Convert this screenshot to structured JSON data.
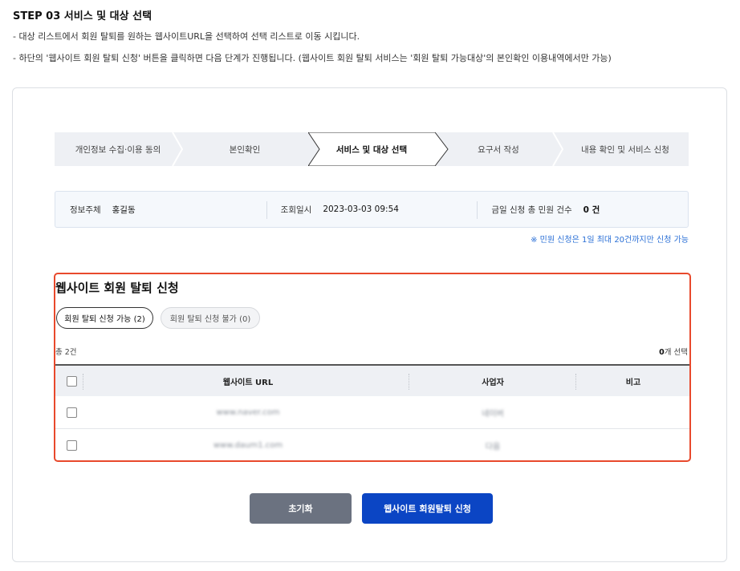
{
  "header": {
    "title": "STEP 03 서비스 및 대상 선택",
    "desc1": "- 대상 리스트에서 회원 탈퇴를 원하는 웹사이트URL을 선택하여 선택 리스트로 이동 시킵니다.",
    "desc2": "- 하단의 '웹사이트 회원 탈퇴 신청' 버튼을 클릭하면 다음 단계가 진행됩니다. (웹사이트 회원 탈퇴 서비스는 '회원 탈퇴 가능대상'의 본인확인 이용내역에서만 가능)"
  },
  "stepper": {
    "steps": [
      {
        "label": "개인정보 수집·이용 동의"
      },
      {
        "label": "본인확인"
      },
      {
        "label": "서비스 및 대상 선택"
      },
      {
        "label": "요구서 작성"
      },
      {
        "label": "내용 확인 및 서비스 신청"
      }
    ],
    "active_index": 2
  },
  "info": {
    "subject_label": "정보주체",
    "subject_value": "홍길동",
    "query_label": "조회일시",
    "query_value": "2023-03-03 09:54",
    "count_label": "금일 신청 총 민원 건수",
    "count_value": "0 건",
    "notice": "※ 민원 신청은 1일 최대 20건까지만 신청 가능"
  },
  "panel": {
    "title": "웹사이트 회원 탈퇴 신청",
    "tab_available": "회원 탈퇴 신청 가능 (2)",
    "tab_unavailable": "회원 탈퇴 신청 불가 (0)",
    "total": "총 2건",
    "selected_count": "0",
    "selected_suffix": "개 선택",
    "columns": {
      "url": "웹사이트 URL",
      "business": "사업자",
      "note": "비고"
    },
    "rows": [
      {
        "url": "www.naver.com",
        "business": "네이버",
        "note": ""
      },
      {
        "url": "www.daum1.com",
        "business": "다음",
        "note": ""
      }
    ]
  },
  "buttons": {
    "reset": "초기화",
    "apply": "웹사이트 회원탈퇴 신청"
  },
  "colors": {
    "accent": "#0b45c4",
    "highlight_border": "#e8492c",
    "notice": "#2a6fd6"
  }
}
